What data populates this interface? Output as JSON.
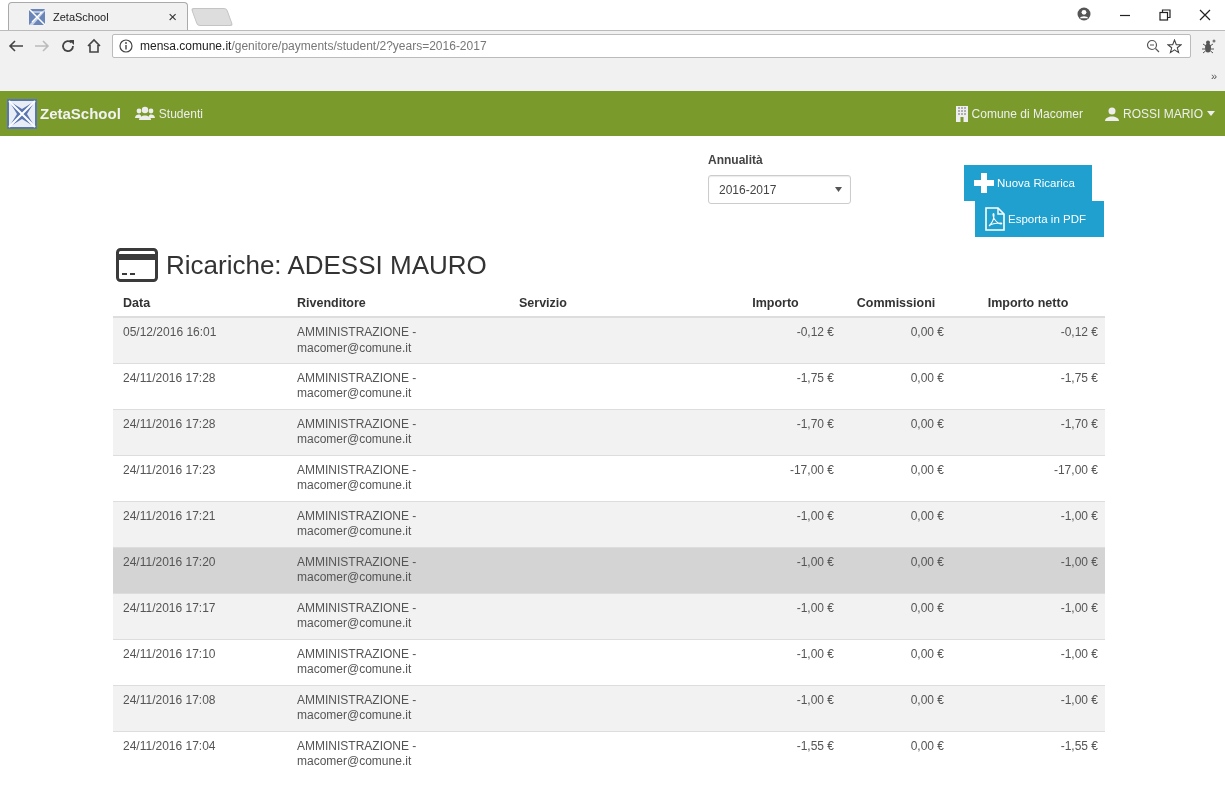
{
  "browser": {
    "tab_title": "ZetaSchool",
    "tab_close": "×",
    "url_host": "mensa.comune.it",
    "url_path": "/genitore/payments/student/2?years=2016-2017",
    "bookmarks_more": "»"
  },
  "navbar": {
    "brand": "ZetaSchool",
    "students": "Studenti",
    "municipality": "Comune di Macomer",
    "user": "ROSSI MARIO"
  },
  "filter": {
    "label": "Annualità",
    "value": "2016-2017"
  },
  "buttons": [
    {
      "kind": "plus",
      "label": "Nuova Ricarica"
    },
    {
      "kind": "pdf",
      "label": "Esporta in PDF"
    }
  ],
  "heading": "Ricariche: ADESSI MAURO",
  "table": {
    "columns": [
      "Data",
      "Rivenditore",
      "Servizio",
      "Importo",
      "Commissioni",
      "Importo netto"
    ],
    "rows": [
      {
        "date": "05/12/2016 16:01",
        "seller": [
          "AMMINISTRAZIONE -",
          "macomer@comune.it"
        ],
        "amount": "-0,12 €",
        "fee": "0,00 €",
        "net": "-0,12 €",
        "highlighted": false
      },
      {
        "date": "24/11/2016 17:28",
        "seller": [
          "AMMINISTRAZIONE -",
          "macomer@comune.it"
        ],
        "amount": "-1,75 €",
        "fee": "0,00 €",
        "net": "-1,75 €",
        "highlighted": false
      },
      {
        "date": "24/11/2016 17:28",
        "seller": [
          "AMMINISTRAZIONE -",
          "macomer@comune.it"
        ],
        "amount": "-1,70 €",
        "fee": "0,00 €",
        "net": "-1,70 €",
        "highlighted": false
      },
      {
        "date": "24/11/2016 17:23",
        "seller": [
          "AMMINISTRAZIONE -",
          "macomer@comune.it"
        ],
        "amount": "-17,00 €",
        "fee": "0,00 €",
        "net": "-17,00 €",
        "highlighted": false
      },
      {
        "date": "24/11/2016 17:21",
        "seller": [
          "AMMINISTRAZIONE -",
          "macomer@comune.it"
        ],
        "amount": "-1,00 €",
        "fee": "0,00 €",
        "net": "-1,00 €",
        "highlighted": false
      },
      {
        "date": "24/11/2016 17:20",
        "seller": [
          "AMMINISTRAZIONE -",
          "macomer@comune.it"
        ],
        "amount": "-1,00 €",
        "fee": "0,00 €",
        "net": "-1,00 €",
        "highlighted": true
      },
      {
        "date": "24/11/2016 17:17",
        "seller": [
          "AMMINISTRAZIONE -",
          "macomer@comune.it"
        ],
        "amount": "-1,00 €",
        "fee": "0,00 €",
        "net": "-1,00 €",
        "highlighted": false
      },
      {
        "date": "24/11/2016 17:10",
        "seller": [
          "AMMINISTRAZIONE -",
          "macomer@comune.it"
        ],
        "amount": "-1,00 €",
        "fee": "0,00 €",
        "net": "-1,00 €",
        "highlighted": false
      },
      {
        "date": "24/11/2016 17:08",
        "seller": [
          "AMMINISTRAZIONE -",
          "macomer@comune.it"
        ],
        "amount": "-1,00 €",
        "fee": "0,00 €",
        "net": "-1,00 €",
        "highlighted": false
      },
      {
        "date": "24/11/2016 17:04",
        "seller": [
          "AMMINISTRAZIONE -",
          "macomer@comune.it"
        ],
        "amount": "-1,55 €",
        "fee": "0,00 €",
        "net": "-1,55 €",
        "highlighted": false
      }
    ]
  }
}
